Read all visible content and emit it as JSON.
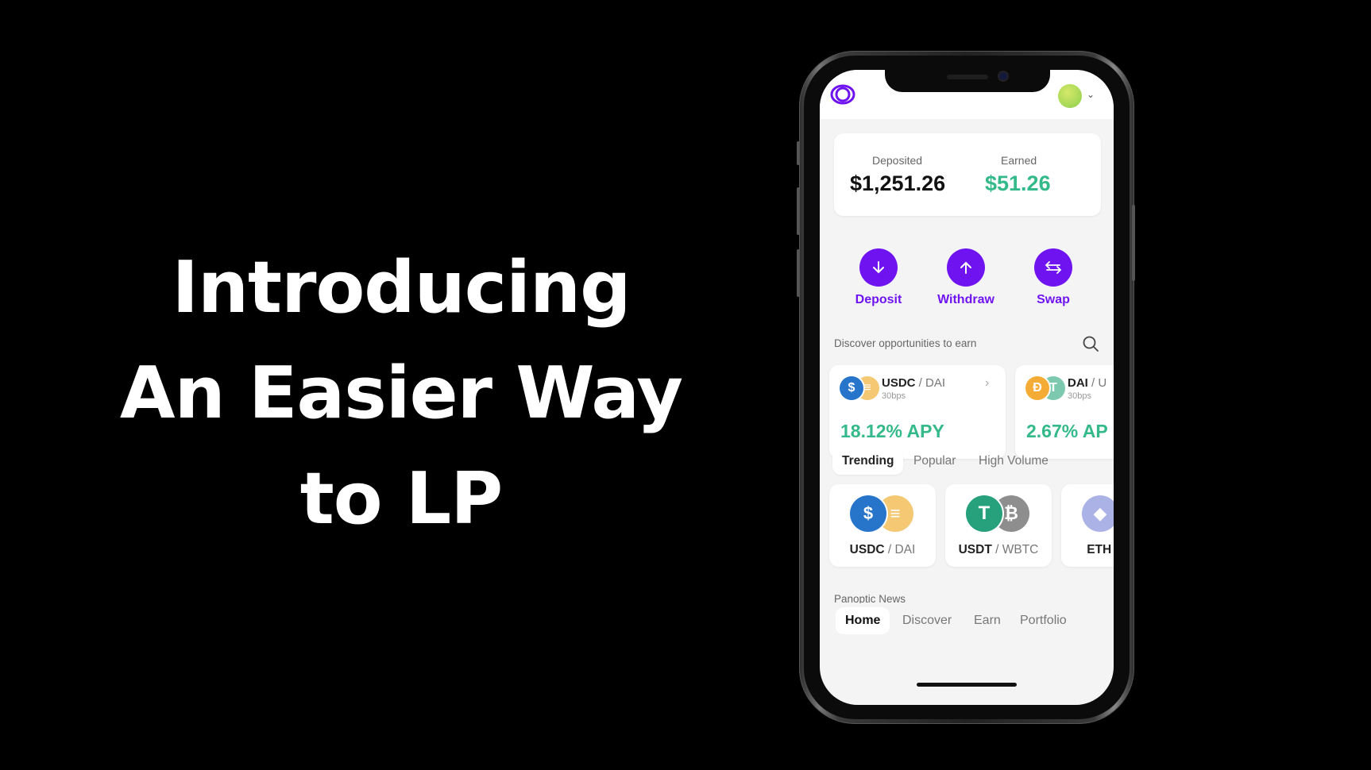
{
  "headline": {
    "line1": "Introducing",
    "line2": "An Easier Way",
    "line3": "to LP"
  },
  "app": {
    "logo_icon": "panoptic-logo",
    "avatar_icon": "user-avatar",
    "balances": {
      "deposited_label": "Deposited",
      "deposited_value": "$1,251.26",
      "earned_label": "Earned",
      "earned_value": "$51.26"
    },
    "actions": [
      {
        "label": "Deposit",
        "icon": "arrow-down-icon"
      },
      {
        "label": "Withdraw",
        "icon": "arrow-up-icon"
      },
      {
        "label": "Swap",
        "icon": "swap-icon"
      }
    ],
    "discover_label": "Discover opportunities to earn",
    "pools": [
      {
        "base": "USDC",
        "sep": " / DAI",
        "fee": "30bps",
        "apy": "18.12% APY"
      },
      {
        "base": "DAI",
        "sep": " / U",
        "fee": "30bps",
        "apy": "2.67% AP"
      }
    ],
    "tabs": [
      "Trending",
      "Popular",
      "High Volume"
    ],
    "trending": [
      {
        "base": "USDC",
        "sep": " / DAI"
      },
      {
        "base": "USDT",
        "sep": " / WBTC"
      },
      {
        "base": "ETH",
        "sep": " /"
      }
    ],
    "news_label": "Panoptic News",
    "nav": [
      "Home",
      "Discover",
      "Earn",
      "Portfolio"
    ],
    "colors": {
      "accent": "#6f14f0",
      "earned": "#34b98a",
      "usdc": "#2775ca",
      "dai": "#f5ac37",
      "usdt": "#26a17b",
      "wbtc": "#8e8e8e",
      "eth": "#8a92b2"
    }
  }
}
